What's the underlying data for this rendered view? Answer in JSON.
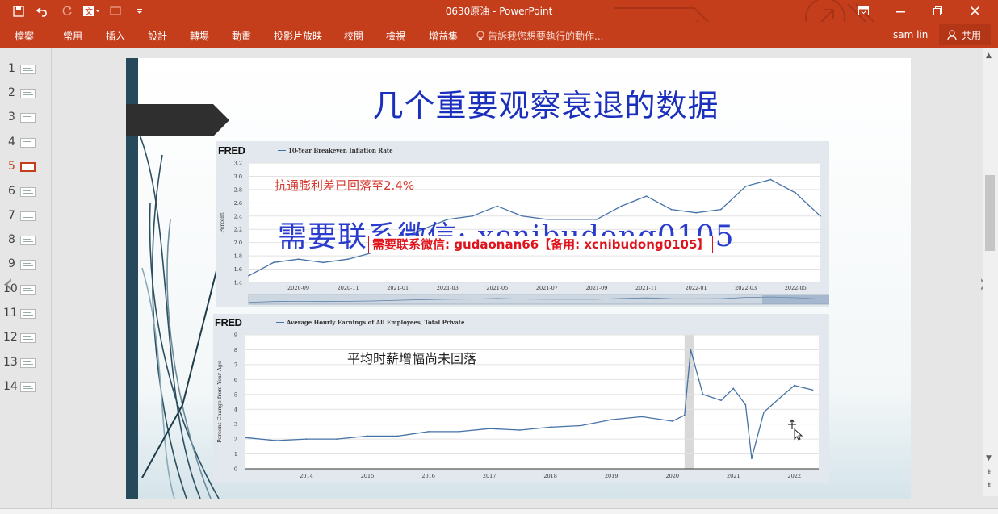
{
  "window": {
    "title": "0630原油 - PowerPoint",
    "user": "sam lin",
    "share_label": "共用"
  },
  "ribbon": {
    "tabs": [
      "檔案",
      "常用",
      "插入",
      "設計",
      "轉場",
      "動畫",
      "投影片放映",
      "校閱",
      "檢視",
      "增益集"
    ],
    "tell_me": "告訴我您想要執行的動作..."
  },
  "thumbnails": {
    "numbers": [
      "1",
      "2",
      "3",
      "4",
      "5",
      "6",
      "7",
      "8",
      "9",
      "10",
      "11",
      "12",
      "13",
      "14"
    ],
    "active_index": 5
  },
  "slide": {
    "title": "几个重要观察衰退的数据",
    "watermark_big": "需要联系微信: xcnibudong0105",
    "watermark_small": "需要联系微信: gudaonan66【备用: xcnibudong0105】",
    "accent_color": "#264a5b"
  },
  "chart_data": [
    {
      "type": "line",
      "brand": "FRED",
      "title": "10-Year Breakeven Inflation Rate",
      "ylabel": "Percent",
      "annotation": "抗通膨利差已回落至2.4%",
      "ylim": [
        1.4,
        3.2
      ],
      "yticks": [
        "1.4",
        "1.6",
        "1.8",
        "2.0",
        "2.2",
        "2.4",
        "2.6",
        "2.8",
        "3.0",
        "3.2"
      ],
      "xticks": [
        "2020-09",
        "2020-11",
        "2021-01",
        "2021-03",
        "2021-05",
        "2021-07",
        "2021-09",
        "2021-11",
        "2022-01",
        "2022-03",
        "2022-05"
      ],
      "x": [
        "2020-07",
        "2020-08",
        "2020-09",
        "2020-10",
        "2020-11",
        "2020-12",
        "2021-01",
        "2021-02",
        "2021-03",
        "2021-04",
        "2021-05",
        "2021-06",
        "2021-07",
        "2021-08",
        "2021-09",
        "2021-10",
        "2021-11",
        "2021-12",
        "2022-01",
        "2022-02",
        "2022-03",
        "2022-04",
        "2022-05",
        "2022-06"
      ],
      "values": [
        1.5,
        1.7,
        1.75,
        1.7,
        1.75,
        1.85,
        2.05,
        2.2,
        2.35,
        2.4,
        2.55,
        2.4,
        2.35,
        2.35,
        2.35,
        2.55,
        2.7,
        2.5,
        2.45,
        2.5,
        2.85,
        2.95,
        2.75,
        2.4
      ],
      "grid": true,
      "line_color": "#4572a7"
    },
    {
      "type": "line",
      "brand": "FRED",
      "title": "Average Hourly Earnings of All Employees, Total Private",
      "ylabel": "Percent Change from Year Ago",
      "annotation": "平均时薪增幅尚未回落",
      "ylim": [
        0,
        9
      ],
      "yticks": [
        "0",
        "1",
        "2",
        "3",
        "4",
        "5",
        "6",
        "7",
        "8",
        "9"
      ],
      "xticks": [
        "2014",
        "2015",
        "2016",
        "2017",
        "2018",
        "2019",
        "2020",
        "2021",
        "2022"
      ],
      "x": [
        2013.0,
        2013.5,
        2014.0,
        2014.5,
        2015.0,
        2015.5,
        2016.0,
        2016.5,
        2017.0,
        2017.5,
        2018.0,
        2018.5,
        2019.0,
        2019.5,
        2020.0,
        2020.2,
        2020.3,
        2020.5,
        2020.8,
        2021.0,
        2021.2,
        2021.3,
        2021.5,
        2021.8,
        2022.0,
        2022.3
      ],
      "values": [
        2.1,
        1.9,
        2.0,
        2.0,
        2.2,
        2.2,
        2.5,
        2.5,
        2.7,
        2.6,
        2.8,
        2.9,
        3.3,
        3.5,
        3.2,
        3.6,
        8.0,
        5.0,
        4.6,
        5.4,
        4.3,
        0.7,
        3.8,
        4.9,
        5.6,
        5.3
      ],
      "recession_band": [
        "2020.2",
        "2020.35"
      ],
      "grid": true,
      "line_color": "#4572a7"
    }
  ]
}
